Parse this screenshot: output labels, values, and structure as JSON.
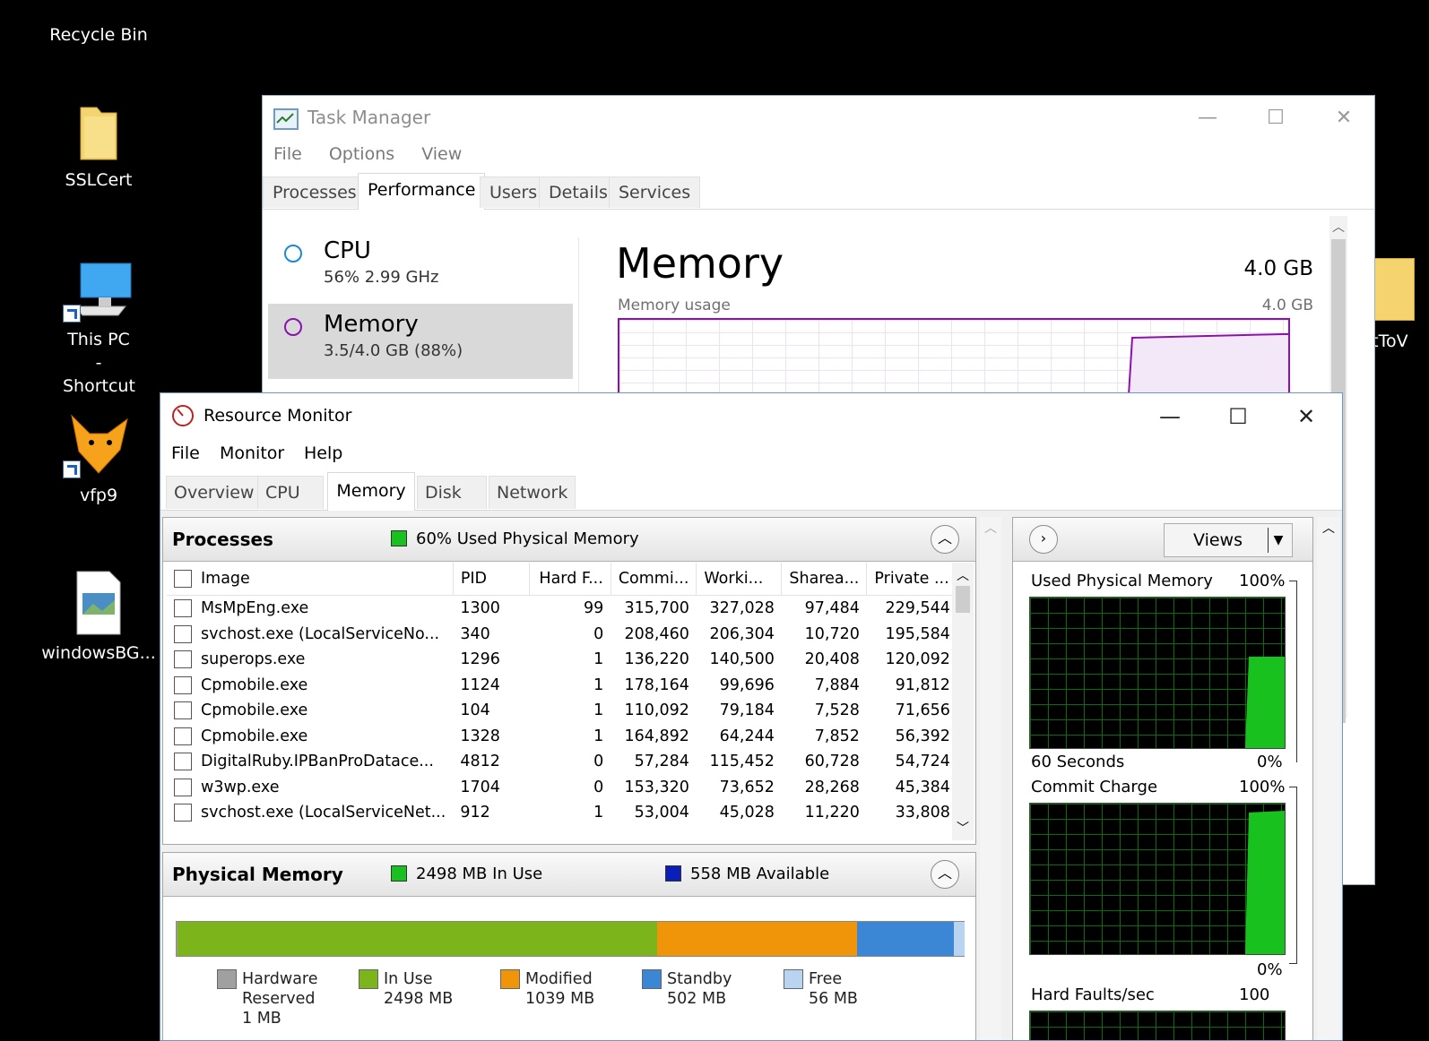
{
  "desktop": {
    "icons": [
      {
        "label": "Recycle Bin"
      },
      {
        "label": "SSLCert"
      },
      {
        "label": "This PC - Shortcut"
      },
      {
        "label": "vfp9"
      },
      {
        "label": "windowsBG..."
      },
      {
        "label": "pdtToV"
      }
    ]
  },
  "task_manager": {
    "title": "Task Manager",
    "menu": [
      "File",
      "Options",
      "View"
    ],
    "tabs": [
      "Processes",
      "Performance",
      "Users",
      "Details",
      "Services"
    ],
    "active_tab": "Performance",
    "side": [
      {
        "name": "CPU",
        "sub": "56%  2.99 GHz",
        "color": "#1b8ad6"
      },
      {
        "name": "Memory",
        "sub": "3.5/4.0 GB (88%)",
        "color": "#8b12ae"
      }
    ],
    "heading": "Memory",
    "capacity": "4.0 GB",
    "usage_label": "Memory usage",
    "usage_max": "4.0 GB"
  },
  "resource_monitor": {
    "title": "Resource Monitor",
    "menu": [
      "File",
      "Monitor",
      "Help"
    ],
    "tabs": [
      "Overview",
      "CPU",
      "Memory",
      "Disk",
      "Network"
    ],
    "active_tab": "Memory",
    "processes": {
      "title": "Processes",
      "status": "60% Used Physical Memory",
      "columns": [
        "Image",
        "PID",
        "Hard F...",
        "Commi...",
        "Worki...",
        "Sharea...",
        "Private ..."
      ],
      "rows": [
        [
          "MsMpEng.exe",
          "1300",
          "99",
          "315,700",
          "327,028",
          "97,484",
          "229,544"
        ],
        [
          "svchost.exe (LocalServiceNo...",
          "340",
          "0",
          "208,460",
          "206,304",
          "10,720",
          "195,584"
        ],
        [
          "superops.exe",
          "1296",
          "1",
          "136,220",
          "140,500",
          "20,408",
          "120,092"
        ],
        [
          "Cpmobile.exe",
          "1124",
          "1",
          "178,164",
          "99,696",
          "7,884",
          "91,812"
        ],
        [
          "Cpmobile.exe",
          "104",
          "1",
          "110,092",
          "79,184",
          "7,528",
          "71,656"
        ],
        [
          "Cpmobile.exe",
          "1328",
          "1",
          "164,892",
          "64,244",
          "7,852",
          "56,392"
        ],
        [
          "DigitalRuby.IPBanProDatace...",
          "4812",
          "0",
          "57,284",
          "115,452",
          "60,728",
          "54,724"
        ],
        [
          "w3wp.exe",
          "1704",
          "0",
          "153,320",
          "73,652",
          "28,268",
          "45,384"
        ],
        [
          "svchost.exe (LocalServiceNet...",
          "912",
          "1",
          "53,004",
          "45,028",
          "11,220",
          "33,808"
        ]
      ]
    },
    "physical": {
      "title": "Physical Memory",
      "in_use": "2498 MB In Use",
      "available": "558 MB Available",
      "segments": [
        {
          "name": "Hardware Reserved",
          "value": "1 MB",
          "mb": 1,
          "color": "#a0a0a0"
        },
        {
          "name": "In Use",
          "value": "2498 MB",
          "mb": 2498,
          "color": "#7cb41b"
        },
        {
          "name": "Modified",
          "value": "1039 MB",
          "mb": 1039,
          "color": "#f0940a"
        },
        {
          "name": "Standby",
          "value": "502 MB",
          "mb": 502,
          "color": "#3c86d6"
        },
        {
          "name": "Free",
          "value": "56 MB",
          "mb": 56,
          "color": "#b8d4f0"
        }
      ]
    },
    "graphs": {
      "views_label": "Views",
      "used_title": "Used Physical Memory",
      "used_max": "100%",
      "used_time": "60 Seconds",
      "used_min": "0%",
      "commit_title": "Commit Charge",
      "commit_max": "100%",
      "commit_min": "0%",
      "faults_title": "Hard Faults/sec",
      "faults_max": "100"
    }
  }
}
